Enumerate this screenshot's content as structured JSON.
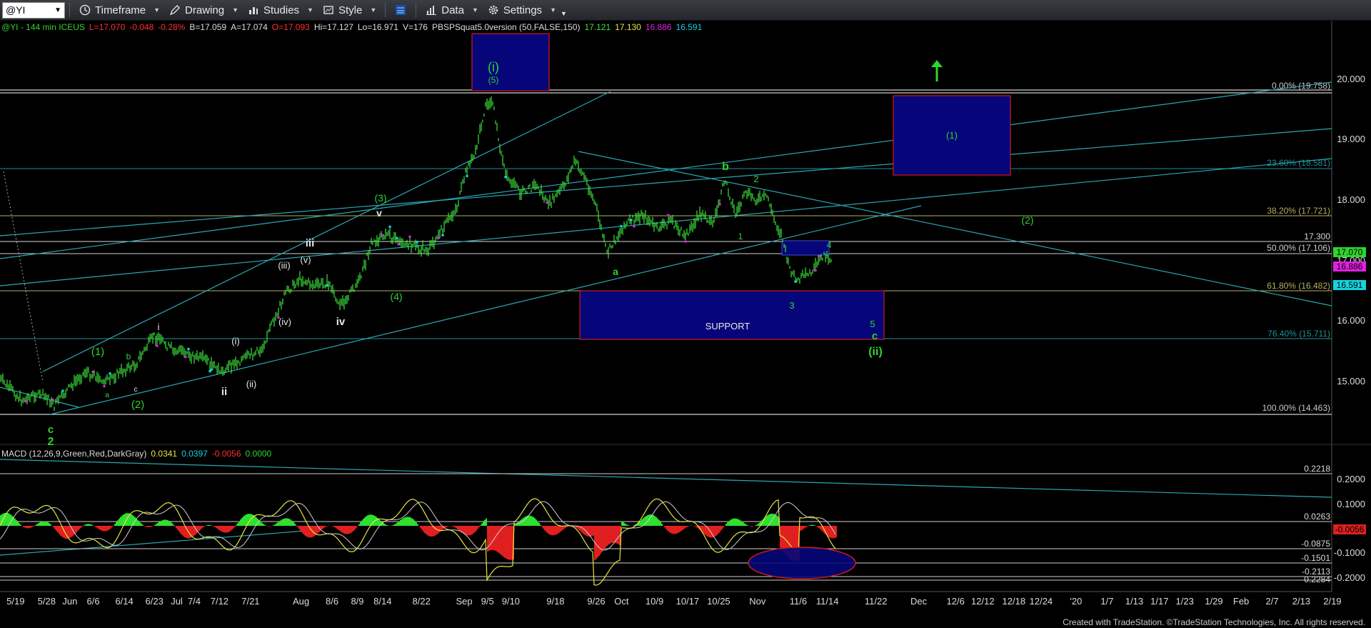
{
  "toolbar": {
    "symbol": "@YI",
    "timeframe": "Timeframe",
    "drawing": "Drawing",
    "studies": "Studies",
    "style": "Style",
    "data": "Data",
    "settings": "Settings"
  },
  "status": {
    "symbol_info": "@YI - 144 min  ICEUS",
    "last": "L=17.070",
    "change": "-0.048",
    "change_pct": "-0.28%",
    "bid": "B=17.059",
    "ask": "A=17.074",
    "open": "O=17.093",
    "high": "Hi=17.127",
    "low": "Lo=16.971",
    "volume": "V=176",
    "study": "PBSPSquat5.0version (50,FALSE,150)",
    "study_v1": "17.121",
    "study_v2": "17.130",
    "study_v3": "16.886",
    "study_v4": "16.591"
  },
  "macd_status": {
    "name": "MACD (12,26,9,Green,Red,DarkGray)",
    "v1": "0.0341",
    "v2": "0.0397",
    "v3": "-0.0056",
    "v4": "0.0000"
  },
  "colors": {
    "price_bars": "#3de23d",
    "wave_green": "#2fd42f",
    "wave_white": "#e6e6e6",
    "box_fill": "#06067a",
    "box_border": "#d01a1a",
    "trendline": "#2aa7b5",
    "fib_line": "#cfcfcf"
  },
  "price_axis": {
    "ticks": [
      "20.000",
      "19.000",
      "18.000",
      "17.000",
      "16.000",
      "15.000"
    ],
    "badges": [
      {
        "text": "17.070",
        "bg": "#2fd42f",
        "fg": "#000"
      },
      {
        "text": "16.886",
        "bg": "#e020e0",
        "fg": "#000"
      },
      {
        "text": "16.591",
        "bg": "#10d4e0",
        "fg": "#000"
      }
    ]
  },
  "macd_axis": {
    "ticks": [
      "0.2000",
      "0.1000",
      "-0.1000",
      "-0.2000"
    ],
    "levels": [
      "0.2218",
      "0.0263",
      "-0.0875",
      "-0.1501",
      "-0.2113",
      "-0.2284"
    ],
    "badge": "-0.0056"
  },
  "fib_levels": [
    {
      "label": "0.00% (19.758)",
      "color": "#c8c8c8"
    },
    {
      "label": "23.60% (18.581)",
      "color": "#1f8f9a"
    },
    {
      "label": "38.20% (17.721)",
      "color": "#b4b060"
    },
    {
      "label": "17.300",
      "color": "#d8d8d8"
    },
    {
      "label": "50.00% (17.106)",
      "color": "#cfcfcf"
    },
    {
      "label": "61.80% (16.482)",
      "color": "#b4b060"
    },
    {
      "label": "76.40% (15.711)",
      "color": "#1f8f9a"
    },
    {
      "label": "100.00% (14.463)",
      "color": "#c8c8c8"
    }
  ],
  "boxes": {
    "support": "SUPPORT",
    "target1": "(1)",
    "top_wave": "(i)",
    "top_wave_sub": "(5)"
  },
  "wave_labels_green": [
    "(1)",
    "(2)",
    "b",
    "c",
    "2",
    "(3)",
    "(4)",
    "b",
    "2",
    "1",
    "a",
    "3",
    "4",
    "5",
    "c",
    "(ii)",
    "(2)"
  ],
  "wave_labels_white": [
    "i",
    "ii",
    "(i)",
    "(ii)",
    "(iii)",
    "(iv)",
    "(v)",
    "iii",
    "iv",
    "v",
    "a",
    "c"
  ],
  "time_axis": [
    "5/19",
    "5/28",
    "Jun",
    "6/6",
    "6/14",
    "6/23",
    "Jul",
    "7/4",
    "7/12",
    "7/21",
    "Aug",
    "8/6",
    "8/9",
    "8/14",
    "8/22",
    "Sep",
    "9/5",
    "9/10",
    "9/18",
    "9/26",
    "Oct",
    "10/9",
    "10/17",
    "10/25",
    "Nov",
    "11/6",
    "11/14",
    "11/22",
    "Dec",
    "12/6",
    "12/12",
    "12/18",
    "12/24",
    "'20",
    "1/7",
    "1/13",
    "1/17",
    "1/23",
    "1/29",
    "Feb",
    "2/7",
    "2/13",
    "2/19"
  ],
  "footer": "Created with TradeStation. ©TradeStation Technologies, Inc. All rights reserved."
}
